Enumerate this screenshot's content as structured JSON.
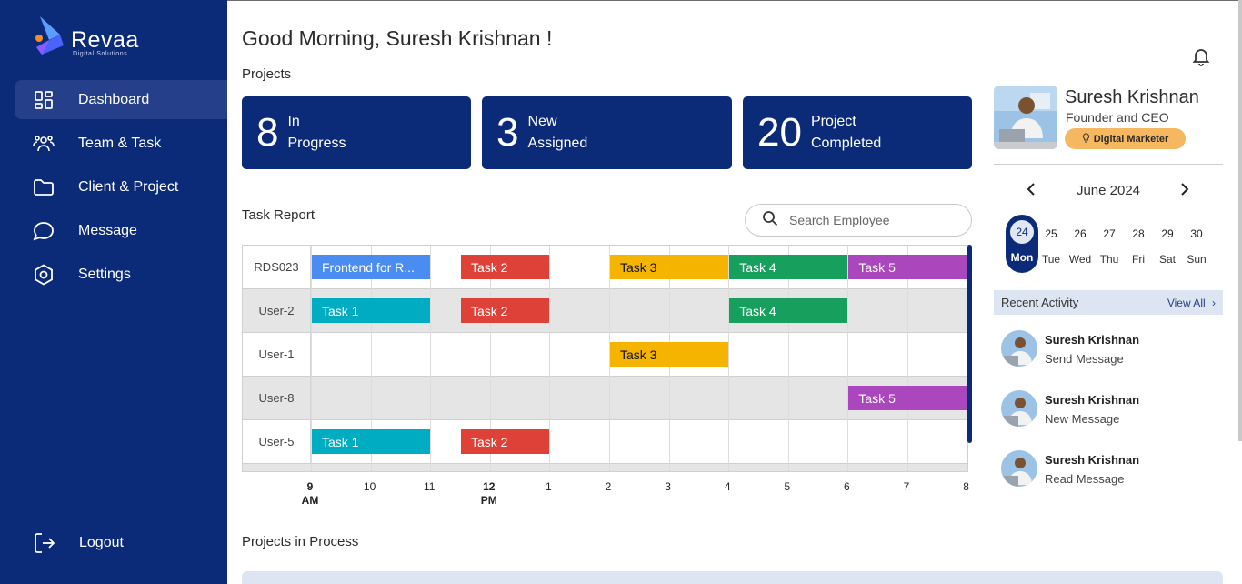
{
  "brand": {
    "name": "Revaa",
    "tagline": "Digital Solutions"
  },
  "sidebar": {
    "items": [
      {
        "label": "Dashboard",
        "icon": "dashboard-icon",
        "active": true
      },
      {
        "label": "Team & Task",
        "icon": "team-icon",
        "active": false
      },
      {
        "label": "Client & Project",
        "icon": "folder-icon",
        "active": false
      },
      {
        "label": "Message",
        "icon": "message-icon",
        "active": false
      },
      {
        "label": "Settings",
        "icon": "gear-icon",
        "active": false
      }
    ],
    "logout": "Logout"
  },
  "header": {
    "greeting": "Good Morning, Suresh Krishnan !"
  },
  "projects": {
    "title": "Projects",
    "stats": [
      {
        "value": "8",
        "line1": "In",
        "line2": "Progress"
      },
      {
        "value": "3",
        "line1": "New",
        "line2": "Assigned"
      },
      {
        "value": "20",
        "line1": "Project",
        "line2": "Completed"
      }
    ]
  },
  "task_report": {
    "title": "Task Report",
    "search_placeholder": "Search Employee",
    "rows": [
      {
        "label": "RDS023",
        "tasks": [
          {
            "name": "Frontend for R...",
            "start": 9,
            "end": 11,
            "color": "#4a8cf0"
          },
          {
            "name": "Task 2",
            "start": 11.5,
            "end": 13,
            "color": "#dd4137"
          },
          {
            "name": "Task 3",
            "start": 14,
            "end": 16,
            "color": "#f4b400"
          },
          {
            "name": "Task 4",
            "start": 16,
            "end": 18,
            "color": "#17a05d"
          },
          {
            "name": "Task 5",
            "start": 18,
            "end": 20,
            "color": "#ab47bc"
          }
        ]
      },
      {
        "label": "User-2",
        "tasks": [
          {
            "name": "Task 1",
            "start": 9,
            "end": 11,
            "color": "#00acc1"
          },
          {
            "name": "Task 2",
            "start": 11.5,
            "end": 13,
            "color": "#dd4137"
          },
          {
            "name": "Task 4",
            "start": 16,
            "end": 18,
            "color": "#17a05d"
          }
        ]
      },
      {
        "label": "User-1",
        "tasks": [
          {
            "name": "Task 3",
            "start": 14,
            "end": 16,
            "color": "#f4b400"
          }
        ]
      },
      {
        "label": "User-8",
        "tasks": [
          {
            "name": "Task 5",
            "start": 18,
            "end": 20,
            "color": "#ab47bc"
          }
        ]
      },
      {
        "label": "User-5",
        "tasks": [
          {
            "name": "Task 1",
            "start": 9,
            "end": 11,
            "color": "#00acc1"
          },
          {
            "name": "Task 2",
            "start": 11.5,
            "end": 13,
            "color": "#dd4137"
          }
        ]
      }
    ],
    "ticks": [
      {
        "hour": 9,
        "label": "9",
        "sub": "AM",
        "bold": true
      },
      {
        "hour": 10,
        "label": "10",
        "sub": "",
        "bold": false
      },
      {
        "hour": 11,
        "label": "11",
        "sub": "",
        "bold": false
      },
      {
        "hour": 12,
        "label": "12",
        "sub": "PM",
        "bold": true
      },
      {
        "hour": 13,
        "label": "1",
        "sub": "",
        "bold": false
      },
      {
        "hour": 14,
        "label": "2",
        "sub": "",
        "bold": false
      },
      {
        "hour": 15,
        "label": "3",
        "sub": "",
        "bold": false
      },
      {
        "hour": 16,
        "label": "4",
        "sub": "",
        "bold": false
      },
      {
        "hour": 17,
        "label": "5",
        "sub": "",
        "bold": false
      },
      {
        "hour": 18,
        "label": "6",
        "sub": "",
        "bold": false
      },
      {
        "hour": 19,
        "label": "7",
        "sub": "",
        "bold": false
      },
      {
        "hour": 20,
        "label": "8",
        "sub": "",
        "bold": false
      }
    ]
  },
  "projects_in_process": {
    "title": "Projects in Process"
  },
  "profile": {
    "name": "Suresh Krishnan",
    "role": "Founder and CEO",
    "badge": "Digital Marketer"
  },
  "calendar": {
    "month": "June 2024",
    "days": [
      {
        "d": "24",
        "w": "Mon",
        "selected": true
      },
      {
        "d": "25",
        "w": "Tue",
        "selected": false
      },
      {
        "d": "26",
        "w": "Wed",
        "selected": false
      },
      {
        "d": "27",
        "w": "Thu",
        "selected": false
      },
      {
        "d": "28",
        "w": "Fri",
        "selected": false
      },
      {
        "d": "29",
        "w": "Sat",
        "selected": false
      },
      {
        "d": "30",
        "w": "Sun",
        "selected": false
      }
    ]
  },
  "recent_activity": {
    "title": "Recent Activity",
    "view_all": "View All",
    "items": [
      {
        "name": "Suresh Krishnan",
        "action": "Send Message"
      },
      {
        "name": "Suresh Krishnan",
        "action": "New Message"
      },
      {
        "name": "Suresh Krishnan",
        "action": "Read Message"
      }
    ]
  }
}
